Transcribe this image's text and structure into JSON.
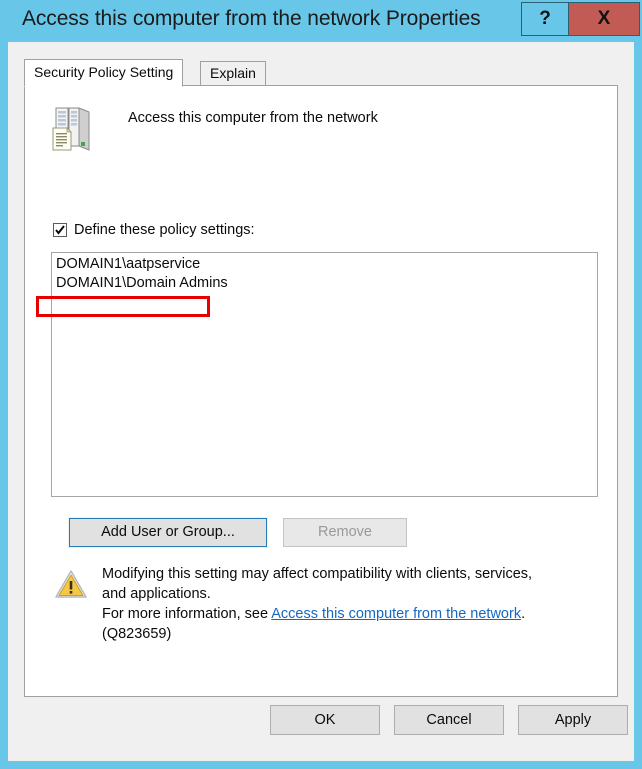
{
  "window": {
    "title": "Access this computer from the network Properties",
    "frame_color": "#68c7e8",
    "client_bg": "#f0f0f0",
    "caption_buttons": {
      "help_label": "?",
      "close_label": "X",
      "close_color": "#c35b55"
    }
  },
  "tabs": [
    {
      "label": "Security Policy Setting",
      "active": true
    },
    {
      "label": "Explain",
      "active": false
    }
  ],
  "policy": {
    "icon": "policy-server-icon",
    "name": "Access this computer from the network"
  },
  "define_setting": {
    "label": "Define these policy settings:",
    "checked": true,
    "check_glyph": "checkmark-icon"
  },
  "listbox": {
    "items": [
      "DOMAIN1\\aatpservice",
      "DOMAIN1\\Domain Admins"
    ],
    "highlighted_item_index": 0,
    "highlight_color": "#e60000"
  },
  "actions": {
    "add_label": "Add User or Group...",
    "remove_label": "Remove",
    "remove_enabled": false,
    "add_focused": true
  },
  "warning": {
    "icon": "warning-triangle-icon",
    "line1": "Modifying this setting may affect compatibility with clients, services,",
    "line2": "and applications.",
    "line3_prefix": "For more information, see ",
    "link_text": "Access this computer from the network",
    "line3_suffix": ".",
    "line4": "(Q823659)",
    "link_color": "#1568c0"
  },
  "dialog_buttons": {
    "ok": "OK",
    "cancel": "Cancel",
    "apply": "Apply"
  }
}
